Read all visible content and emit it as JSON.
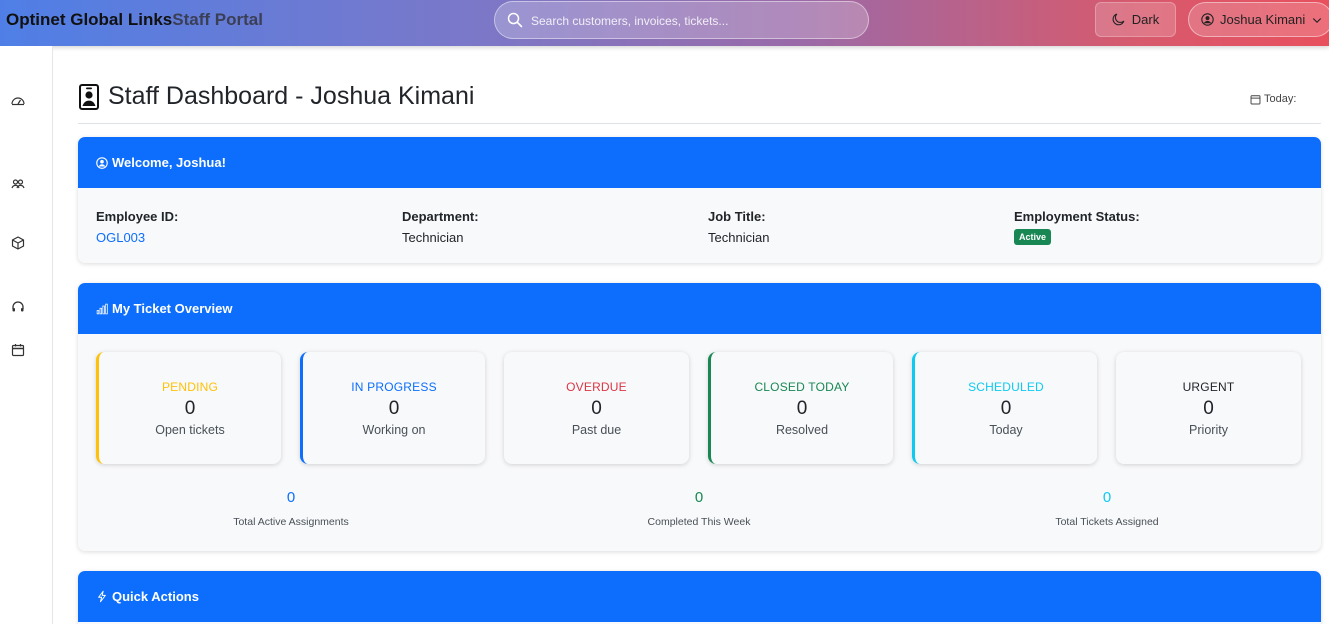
{
  "header": {
    "brand_name": "Optinet Global Links",
    "brand_sub": "Staff Portal",
    "search_placeholder": "Search customers, invoices, tickets...",
    "theme_label": "Dark",
    "user_name": "Joshua Kimani"
  },
  "sidebar": {
    "items": [
      {
        "icon": "speedometer-icon"
      },
      {
        "icon": "people-icon"
      },
      {
        "icon": "box-icon"
      },
      {
        "icon": "headset-icon"
      },
      {
        "icon": "calendar-icon"
      }
    ]
  },
  "page": {
    "title": "Staff Dashboard - Joshua Kimani",
    "today_label": "Today:"
  },
  "welcome": {
    "heading": "Welcome, Joshua!",
    "employee_id_label": "Employee ID:",
    "employee_id": "OGL003",
    "department_label": "Department:",
    "department": "Technician",
    "job_title_label": "Job Title:",
    "job_title": "Technician",
    "status_label": "Employment Status:",
    "status": "Active"
  },
  "overview": {
    "heading": "My Ticket Overview",
    "stats": [
      {
        "title": "PENDING",
        "value": "0",
        "sub": "Open tickets",
        "color": "#ffc107"
      },
      {
        "title": "IN PROGRESS",
        "value": "0",
        "sub": "Working on",
        "color": "#0d6efd"
      },
      {
        "title": "OVERDUE",
        "value": "0",
        "sub": "Past due",
        "color": "#dc3545"
      },
      {
        "title": "CLOSED TODAY",
        "value": "0",
        "sub": "Resolved",
        "color": "#198754"
      },
      {
        "title": "SCHEDULED",
        "value": "0",
        "sub": "Today",
        "color": "#0dcaf0"
      },
      {
        "title": "URGENT",
        "value": "0",
        "sub": "Priority",
        "color": "#212529"
      }
    ],
    "summary": [
      {
        "value": "0",
        "label": "Total Active Assignments",
        "color": "#0d6efd"
      },
      {
        "value": "0",
        "label": "Completed This Week",
        "color": "#198754"
      },
      {
        "value": "0",
        "label": "Total Tickets Assigned",
        "color": "#0dcaf0"
      }
    ]
  },
  "quick_actions": {
    "heading": "Quick Actions"
  }
}
